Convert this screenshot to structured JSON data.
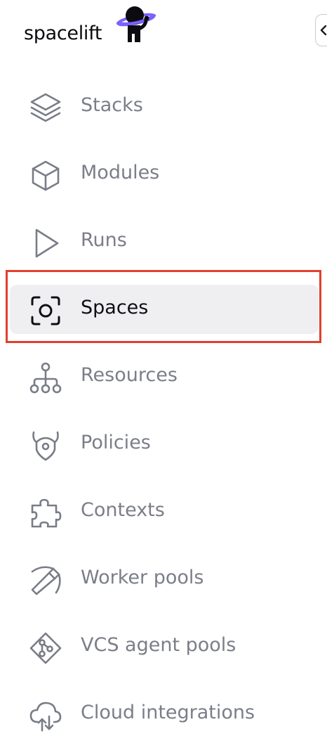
{
  "brand": {
    "name": "spacelift",
    "accent": "#7b61ff"
  },
  "collapse": {
    "icon": "chevron-left-icon"
  },
  "nav": {
    "items": [
      {
        "label": "Stacks",
        "icon": "layers-icon",
        "active": false
      },
      {
        "label": "Modules",
        "icon": "cube-icon",
        "active": false
      },
      {
        "label": "Runs",
        "icon": "play-icon",
        "active": false
      },
      {
        "label": "Spaces",
        "icon": "focus-target-icon",
        "active": true
      },
      {
        "label": "Resources",
        "icon": "hierarchy-icon",
        "active": false
      },
      {
        "label": "Policies",
        "icon": "shield-horns-icon",
        "active": false
      },
      {
        "label": "Contexts",
        "icon": "puzzle-icon",
        "active": false
      },
      {
        "label": "Worker pools",
        "icon": "pickaxe-icon",
        "active": false
      },
      {
        "label": "VCS agent pools",
        "icon": "git-diamond-icon",
        "active": false
      },
      {
        "label": "Cloud integrations",
        "icon": "cloud-transfer-icon",
        "active": false
      }
    ]
  },
  "colors": {
    "inactive_text": "#7b7e89",
    "active_text": "#0e0f14",
    "active_bg": "#efeff2",
    "highlight_border": "#e0402e"
  }
}
